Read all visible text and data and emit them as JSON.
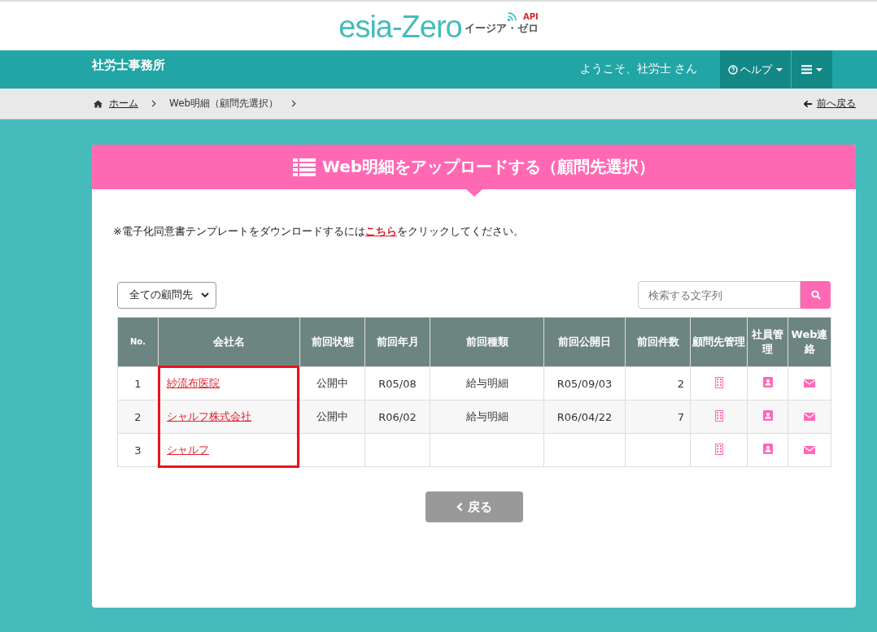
{
  "logo": {
    "name": "esia-Zero",
    "badge": "API",
    "reading": "イージア・ゼロ"
  },
  "navbar": {
    "office": "社労士事務所",
    "welcome": "ようこそ、社労士 さん",
    "help": "ヘルプ"
  },
  "breadcrumb": {
    "items": [
      "ホーム",
      "Web明細（顧問先選択）"
    ],
    "back": "前へ戻る"
  },
  "card": {
    "title": "Web明細をアップロードする（顧問先選択）",
    "notice": {
      "before": "※電子化同意書テンプレートをダウンロードするには",
      "link": "こちら",
      "after": "をクリックしてください。"
    },
    "filter": {
      "value": "全ての顧問先"
    },
    "search": {
      "placeholder": "検索する文字列"
    },
    "table": {
      "columns": [
        {
          "label": "No.",
          "highlighted": false
        },
        {
          "label": "会社名",
          "highlighted": true
        },
        {
          "label": "前回状態",
          "highlighted": false
        },
        {
          "label": "前回年月",
          "highlighted": false
        },
        {
          "label": "前回種類",
          "highlighted": false
        },
        {
          "label": "前回公開日",
          "highlighted": false
        },
        {
          "label": "前回件数",
          "highlighted": false
        },
        {
          "label": "顧問先管理",
          "highlighted": false
        },
        {
          "label": "社員管理",
          "highlighted": false
        },
        {
          "label": "Web連絡",
          "highlighted": false
        }
      ],
      "rows": [
        {
          "no": "1",
          "company": "紗流布医院",
          "status": "公開中",
          "month": "R05/08",
          "type": "給与明細",
          "date": "R05/09/03",
          "count": "2"
        },
        {
          "no": "2",
          "company": "シャルフ株式会社",
          "status": "公開中",
          "month": "R06/02",
          "type": "給与明細",
          "date": "R06/04/22",
          "count": "7"
        },
        {
          "no": "3",
          "company": "シャルフ",
          "status": "",
          "month": "",
          "type": "",
          "date": "",
          "count": ""
        }
      ]
    },
    "back_button": "戻る"
  }
}
